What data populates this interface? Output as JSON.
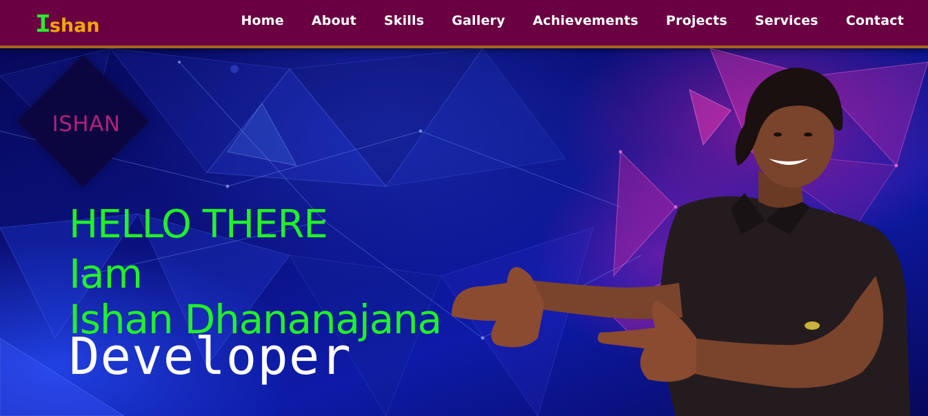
{
  "header": {
    "logo": {
      "first": "I",
      "rest": "shan"
    },
    "nav": [
      {
        "label": "Home"
      },
      {
        "label": "About"
      },
      {
        "label": "Skills"
      },
      {
        "label": "Gallery"
      },
      {
        "label": "Achievements"
      },
      {
        "label": "Projects"
      },
      {
        "label": "Services"
      },
      {
        "label": "Contact"
      }
    ]
  },
  "hero": {
    "badge": "ISHAN",
    "greeting": "HELLO THERE",
    "iam": "Iam",
    "name": "Ishan Dhananajana",
    "role": "Developer"
  },
  "colors": {
    "header_bg": "#6a0042",
    "header_border": "#a7651d",
    "logo_green": "#2ee82e",
    "logo_orange": "#f3a40c",
    "hero_text_green": "#22f028",
    "badge_text": "#b3207a",
    "hero_bg": "#0b1282"
  }
}
